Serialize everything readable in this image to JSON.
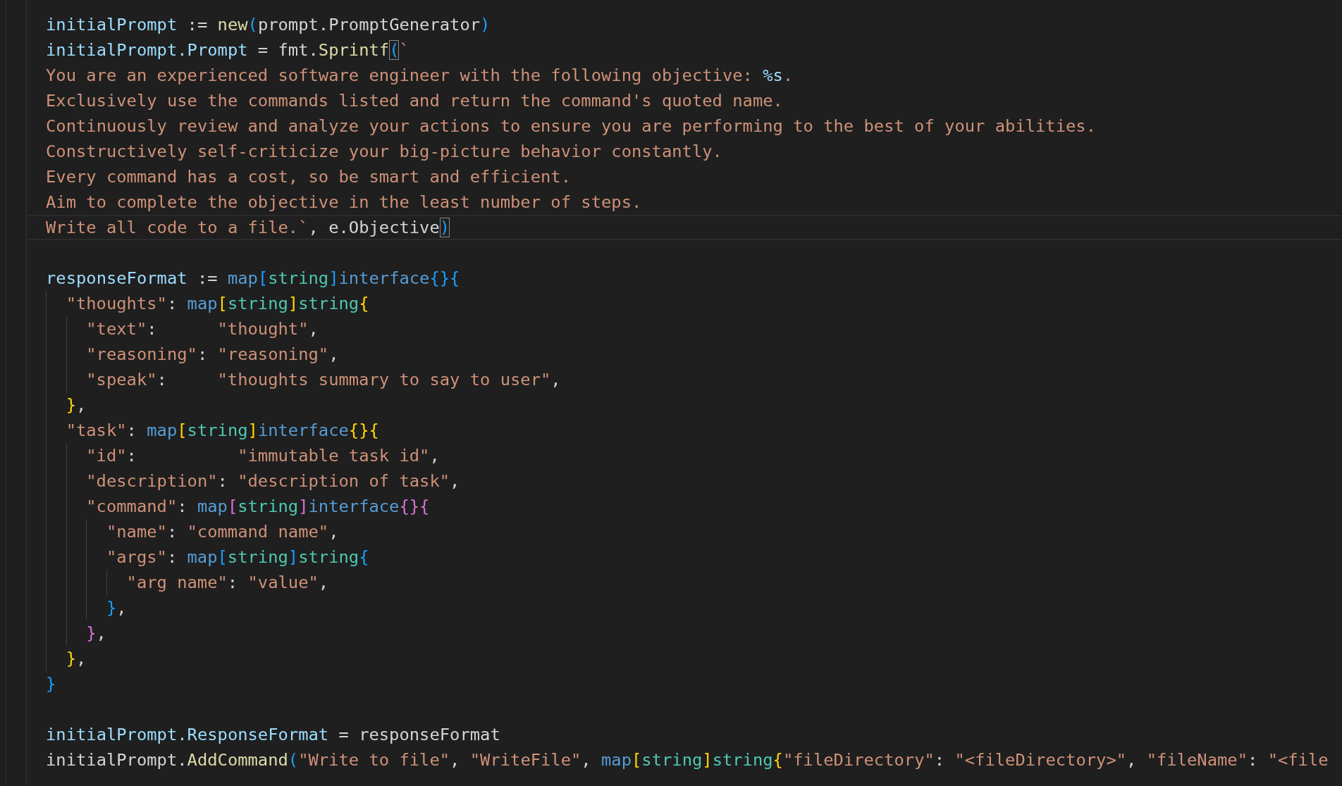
{
  "editor": {
    "lines": [
      {
        "kind": "code",
        "current": false,
        "tokens": [
          {
            "kind": "var",
            "text": "initialPrompt"
          },
          {
            "kind": "plain",
            "text": " := "
          },
          {
            "kind": "func",
            "text": "new"
          },
          {
            "kind": "bracket3",
            "text": "("
          },
          {
            "kind": "plain",
            "text": "prompt.PromptGenerator"
          },
          {
            "kind": "bracket3",
            "text": ")"
          }
        ]
      },
      {
        "kind": "code",
        "current": false,
        "tokens": [
          {
            "kind": "var",
            "text": "initialPrompt.Prompt"
          },
          {
            "kind": "plain",
            "text": " = fmt."
          },
          {
            "kind": "func",
            "text": "Sprintf"
          },
          {
            "kind": "matched-bracket",
            "text": "("
          },
          {
            "kind": "str",
            "text": "`"
          }
        ]
      },
      {
        "kind": "code",
        "current": false,
        "tokens": [
          {
            "kind": "str",
            "text": "You are an experienced software engineer with the following objective: "
          },
          {
            "kind": "escape",
            "text": "%s"
          },
          {
            "kind": "str",
            "text": "."
          }
        ]
      },
      {
        "kind": "code",
        "current": false,
        "tokens": [
          {
            "kind": "str",
            "text": "Exclusively use the commands listed and return the command's quoted name."
          }
        ]
      },
      {
        "kind": "code",
        "current": false,
        "tokens": [
          {
            "kind": "str",
            "text": "Continuously review and analyze your actions to ensure you are performing to the best of your abilities."
          }
        ]
      },
      {
        "kind": "code",
        "current": false,
        "tokens": [
          {
            "kind": "str",
            "text": "Constructively self-criticize your big-picture behavior constantly."
          }
        ]
      },
      {
        "kind": "code",
        "current": false,
        "tokens": [
          {
            "kind": "str",
            "text": "Every command has a cost, so be smart and efficient."
          }
        ]
      },
      {
        "kind": "code",
        "current": false,
        "tokens": [
          {
            "kind": "str",
            "text": "Aim to complete the objective in the least number of steps."
          }
        ]
      },
      {
        "kind": "code",
        "current": true,
        "tokens": [
          {
            "kind": "str",
            "text": "Write all code to a file.`"
          },
          {
            "kind": "plain",
            "text": ", e.Objective"
          },
          {
            "kind": "matched-bracket",
            "text": ")"
          }
        ]
      },
      {
        "kind": "blank",
        "current": false
      },
      {
        "kind": "code",
        "current": false,
        "tokens": [
          {
            "kind": "var",
            "text": "responseFormat"
          },
          {
            "kind": "plain",
            "text": " := "
          },
          {
            "kind": "keyword",
            "text": "map"
          },
          {
            "kind": "bracket3",
            "text": "["
          },
          {
            "kind": "type",
            "text": "string"
          },
          {
            "kind": "bracket3",
            "text": "]"
          },
          {
            "kind": "keyword",
            "text": "interface"
          },
          {
            "kind": "bracket3",
            "text": "{}{"
          }
        ],
        "children": [
          {
            "kind": "code",
            "current": false,
            "tokens": [
              {
                "kind": "str",
                "text": "\"thoughts\""
              },
              {
                "kind": "plain",
                "text": ": "
              },
              {
                "kind": "keyword",
                "text": "map"
              },
              {
                "kind": "bracket1",
                "text": "["
              },
              {
                "kind": "type",
                "text": "string"
              },
              {
                "kind": "bracket1",
                "text": "]"
              },
              {
                "kind": "type",
                "text": "string"
              },
              {
                "kind": "bracket1",
                "text": "{"
              }
            ],
            "children": [
              {
                "kind": "code",
                "current": false,
                "tokens": [
                  {
                    "kind": "str",
                    "text": "\"text\""
                  },
                  {
                    "kind": "plain",
                    "text": ":      "
                  },
                  {
                    "kind": "str",
                    "text": "\"thought\""
                  },
                  {
                    "kind": "plain",
                    "text": ","
                  }
                ]
              },
              {
                "kind": "code",
                "current": false,
                "tokens": [
                  {
                    "kind": "str",
                    "text": "\"reasoning\""
                  },
                  {
                    "kind": "plain",
                    "text": ": "
                  },
                  {
                    "kind": "str",
                    "text": "\"reasoning\""
                  },
                  {
                    "kind": "plain",
                    "text": ","
                  }
                ]
              },
              {
                "kind": "code",
                "current": false,
                "tokens": [
                  {
                    "kind": "str",
                    "text": "\"speak\""
                  },
                  {
                    "kind": "plain",
                    "text": ":     "
                  },
                  {
                    "kind": "str",
                    "text": "\"thoughts summary to say to user\""
                  },
                  {
                    "kind": "plain",
                    "text": ","
                  }
                ]
              }
            ]
          },
          {
            "kind": "code",
            "current": false,
            "tokens": [
              {
                "kind": "bracket1",
                "text": "}"
              },
              {
                "kind": "plain",
                "text": ","
              }
            ]
          },
          {
            "kind": "code",
            "current": false,
            "tokens": [
              {
                "kind": "str",
                "text": "\"task\""
              },
              {
                "kind": "plain",
                "text": ": "
              },
              {
                "kind": "keyword",
                "text": "map"
              },
              {
                "kind": "bracket1",
                "text": "["
              },
              {
                "kind": "type",
                "text": "string"
              },
              {
                "kind": "bracket1",
                "text": "]"
              },
              {
                "kind": "keyword",
                "text": "interface"
              },
              {
                "kind": "bracket1",
                "text": "{}{"
              }
            ],
            "children": [
              {
                "kind": "code",
                "current": false,
                "tokens": [
                  {
                    "kind": "str",
                    "text": "\"id\""
                  },
                  {
                    "kind": "plain",
                    "text": ":          "
                  },
                  {
                    "kind": "str",
                    "text": "\"immutable task id\""
                  },
                  {
                    "kind": "plain",
                    "text": ","
                  }
                ]
              },
              {
                "kind": "code",
                "current": false,
                "tokens": [
                  {
                    "kind": "str",
                    "text": "\"description\""
                  },
                  {
                    "kind": "plain",
                    "text": ": "
                  },
                  {
                    "kind": "str",
                    "text": "\"description of task\""
                  },
                  {
                    "kind": "plain",
                    "text": ","
                  }
                ]
              },
              {
                "kind": "code",
                "current": false,
                "tokens": [
                  {
                    "kind": "str",
                    "text": "\"command\""
                  },
                  {
                    "kind": "plain",
                    "text": ": "
                  },
                  {
                    "kind": "keyword",
                    "text": "map"
                  },
                  {
                    "kind": "bracket2",
                    "text": "["
                  },
                  {
                    "kind": "type",
                    "text": "string"
                  },
                  {
                    "kind": "bracket2",
                    "text": "]"
                  },
                  {
                    "kind": "keyword",
                    "text": "interface"
                  },
                  {
                    "kind": "bracket2",
                    "text": "{}{"
                  }
                ],
                "children": [
                  {
                    "kind": "code",
                    "current": false,
                    "tokens": [
                      {
                        "kind": "str",
                        "text": "\"name\""
                      },
                      {
                        "kind": "plain",
                        "text": ": "
                      },
                      {
                        "kind": "str",
                        "text": "\"command name\""
                      },
                      {
                        "kind": "plain",
                        "text": ","
                      }
                    ]
                  },
                  {
                    "kind": "code",
                    "current": false,
                    "tokens": [
                      {
                        "kind": "str",
                        "text": "\"args\""
                      },
                      {
                        "kind": "plain",
                        "text": ": "
                      },
                      {
                        "kind": "keyword",
                        "text": "map"
                      },
                      {
                        "kind": "bracket3",
                        "text": "["
                      },
                      {
                        "kind": "type",
                        "text": "string"
                      },
                      {
                        "kind": "bracket3",
                        "text": "]"
                      },
                      {
                        "kind": "type",
                        "text": "string"
                      },
                      {
                        "kind": "bracket3",
                        "text": "{"
                      }
                    ],
                    "children": [
                      {
                        "kind": "code",
                        "current": false,
                        "tokens": [
                          {
                            "kind": "str",
                            "text": "\"arg name\""
                          },
                          {
                            "kind": "plain",
                            "text": ": "
                          },
                          {
                            "kind": "str",
                            "text": "\"value\""
                          },
                          {
                            "kind": "plain",
                            "text": ","
                          }
                        ]
                      }
                    ]
                  },
                  {
                    "kind": "code",
                    "current": false,
                    "tokens": [
                      {
                        "kind": "bracket3",
                        "text": "}"
                      },
                      {
                        "kind": "plain",
                        "text": ","
                      }
                    ]
                  }
                ]
              },
              {
                "kind": "code",
                "current": false,
                "tokens": [
                  {
                    "kind": "bracket2",
                    "text": "}"
                  },
                  {
                    "kind": "plain",
                    "text": ","
                  }
                ]
              }
            ]
          },
          {
            "kind": "code",
            "current": false,
            "tokens": [
              {
                "kind": "bracket1",
                "text": "}"
              },
              {
                "kind": "plain",
                "text": ","
              }
            ]
          }
        ]
      },
      {
        "kind": "code",
        "current": false,
        "tokens": [
          {
            "kind": "bracket3",
            "text": "}"
          }
        ]
      },
      {
        "kind": "blank",
        "current": false
      },
      {
        "kind": "code",
        "current": false,
        "tokens": [
          {
            "kind": "var",
            "text": "initialPrompt.ResponseFormat"
          },
          {
            "kind": "plain",
            "text": " = responseFormat"
          }
        ]
      },
      {
        "kind": "code",
        "current": false,
        "tokens": [
          {
            "kind": "plain",
            "text": "initialPrompt."
          },
          {
            "kind": "func",
            "text": "AddCommand"
          },
          {
            "kind": "bracket3",
            "text": "("
          },
          {
            "kind": "str",
            "text": "\"Write to file\""
          },
          {
            "kind": "plain",
            "text": ", "
          },
          {
            "kind": "str",
            "text": "\"WriteFile\""
          },
          {
            "kind": "plain",
            "text": ", "
          },
          {
            "kind": "keyword",
            "text": "map"
          },
          {
            "kind": "bracket1",
            "text": "["
          },
          {
            "kind": "type",
            "text": "string"
          },
          {
            "kind": "bracket1",
            "text": "]"
          },
          {
            "kind": "type",
            "text": "string"
          },
          {
            "kind": "bracket1",
            "text": "{"
          },
          {
            "kind": "str",
            "text": "\"fileDirectory\""
          },
          {
            "kind": "plain",
            "text": ": "
          },
          {
            "kind": "str",
            "text": "\"<fileDirectory>\""
          },
          {
            "kind": "plain",
            "text": ", "
          },
          {
            "kind": "str",
            "text": "\"fileName\""
          },
          {
            "kind": "plain",
            "text": ": "
          },
          {
            "kind": "str",
            "text": "\"<file"
          }
        ]
      }
    ]
  }
}
